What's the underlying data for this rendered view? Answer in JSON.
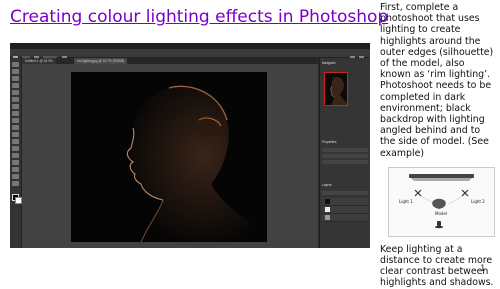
{
  "slide": {
    "title": "Creating colour lighting effects in Photoshop",
    "paragraph_1": "First, complete a photoshoot that uses lighting to create highlights around the outer edges (silhouette) of the model, also known as ‘rim lighting’.",
    "paragraph_2": "Photoshoot needs to be completed in dark environment; black backdrop with lighting angled behind and to the side of model. (See example)",
    "paragraph_3": "Keep lighting at a distance to create more clear contrast between highlights and shadows.",
    "slide_number": "1"
  },
  "diagram": {
    "light_1_label": "Light 1",
    "light_2_label": "Light 2",
    "model_label": "Model"
  },
  "photoshop": {
    "menu_items": [
      "Ps",
      "File",
      "Edit",
      "Image",
      "Layer",
      "Type",
      "Select",
      "Filter",
      "3D",
      "View",
      "Plugins",
      "Window",
      "Help"
    ],
    "doc_tab_1": "Untitled-1 @ 33.3%",
    "doc_tab_2": "rim-lighting.jpg @ 16.7% (RGB/8)",
    "panel_navigator": "Navigator",
    "panel_properties": "Properties",
    "panel_layers": "Layers",
    "accent_color": "#cc2222"
  }
}
